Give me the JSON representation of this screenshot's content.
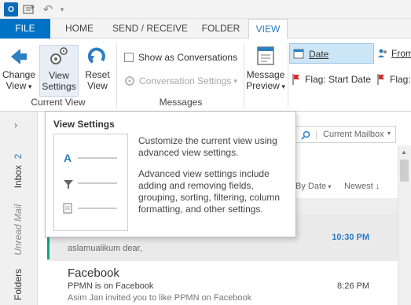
{
  "app": {
    "logo_text": "O"
  },
  "tabs": [
    {
      "label": "FILE"
    },
    {
      "label": "HOME"
    },
    {
      "label": "SEND / RECEIVE"
    },
    {
      "label": "FOLDER"
    },
    {
      "label": "VIEW"
    }
  ],
  "ribbon": {
    "change_view": {
      "line1": "Change",
      "line2": "View"
    },
    "view_settings": {
      "line1": "View",
      "line2": "Settings"
    },
    "reset_view": {
      "line1": "Reset",
      "line2": "View"
    },
    "current_view_group": "Current View",
    "show_as_conversations": "Show as Conversations",
    "conversation_settings": "Conversation Settings",
    "messages_group": "Messages",
    "message_preview": {
      "line1": "Message",
      "line2": "Preview"
    },
    "arrangement": {
      "date": "Date",
      "from": "From",
      "flag_start": "Flag: Start Date",
      "flag_due": "Flag:"
    }
  },
  "search": {
    "scope": "Current Mailbox"
  },
  "sort": {
    "by": "By Date",
    "order": "Newest"
  },
  "nav": {
    "inbox_label": "Inbox",
    "inbox_count": "2",
    "unread_label": "Unread Mail",
    "folders_label": "Folders"
  },
  "tooltip": {
    "title": "View Settings",
    "desc1": "Customize the current view using advanced view settings.",
    "desc2": "Advanced view settings include adding and removing fields, grouping, sorting, filtering, column formatting, and other settings."
  },
  "messages": [
    {
      "sender": "",
      "subject": "",
      "preview": "aslamualikum dear,",
      "time": "10:30 PM",
      "unread": true
    },
    {
      "sender": "Facebook",
      "subject": "PPMN is on Facebook",
      "preview": "Asim Jan invited you to like PPMN on Facebook",
      "time": "8:26 PM",
      "unread": false
    }
  ],
  "colors": {
    "accent": "#0072c6",
    "unread_time": "#2a7bc1",
    "selected_bg": "#cde6f7",
    "flag_red": "#d9302c"
  }
}
